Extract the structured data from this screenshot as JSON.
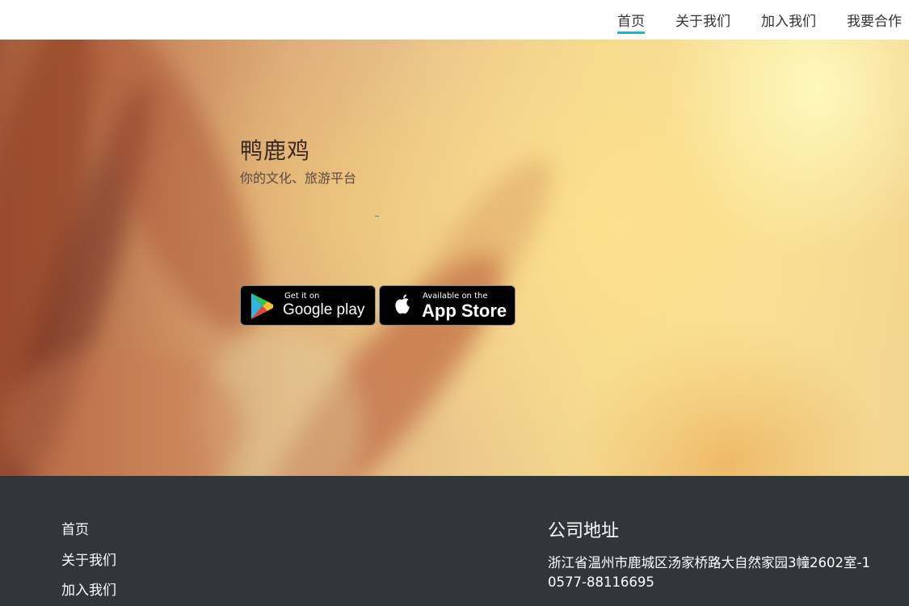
{
  "nav": {
    "items": [
      {
        "label": "首页",
        "active": true
      },
      {
        "label": "关于我们",
        "active": false
      },
      {
        "label": "加入我们",
        "active": false
      },
      {
        "label": "我要合作",
        "active": false
      }
    ],
    "accent_color": "#2ab0c5"
  },
  "hero": {
    "title": "鸭鹿鸡",
    "subtitle": "你的文化、旅游平台",
    "google_play": {
      "small_label": "Get it on",
      "big_label": "Google play",
      "icon": "google-play-icon"
    },
    "app_store": {
      "small_label": "Available on the",
      "big_label": "App Store",
      "icon": "apple-icon"
    }
  },
  "footer": {
    "links": [
      {
        "label": "首页"
      },
      {
        "label": "关于我们"
      },
      {
        "label": "加入我们"
      }
    ],
    "contact": {
      "heading": "公司地址",
      "address": "浙江省温州市鹿城区汤家桥路大自然家园3幢2602室-1",
      "phone": "0577-88116695"
    },
    "background_color": "#31363b"
  }
}
